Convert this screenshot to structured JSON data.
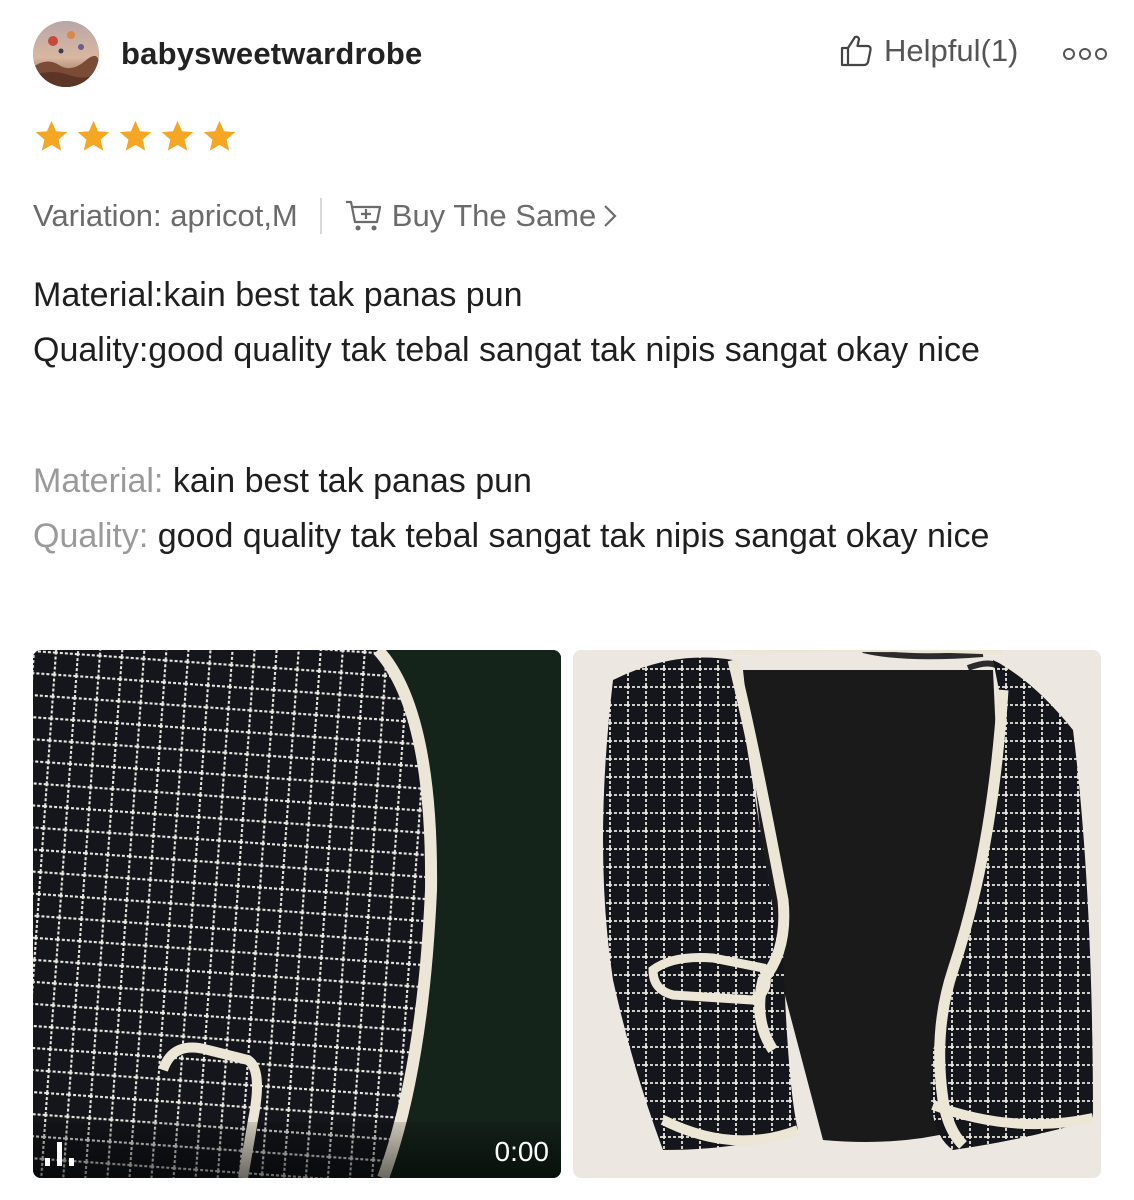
{
  "review": {
    "username": "babysweetwardrobe",
    "helpful_label": "Helpful(1)",
    "rating": 5,
    "variation": "Variation: apricot,M",
    "buy_same_label": "Buy The Same",
    "text_lines": [
      "Material:kain best tak panas pun",
      "Quality:good quality tak tebal sangat tak nipis sangat okay nice"
    ],
    "translated": {
      "material_key": "Material:",
      "material_value": " kain best tak panas pun",
      "quality_key": "Quality:",
      "quality_value": " good quality tak tebal sangat tak nipis sangat okay nice"
    }
  },
  "media": {
    "video_duration": "0:00"
  },
  "icons": {
    "avatar": "balloon-landscape-avatar",
    "helpful": "thumbs-up-icon",
    "more": "more-dots-icon",
    "star": "star-icon",
    "cart": "cart-plus-icon",
    "chevron": "chevron-right-icon",
    "video": "video-indicator-icon"
  },
  "colors": {
    "star": "#f5a623",
    "muted_text": "#6b6b6b",
    "key_text": "#9a9a9a",
    "fabric_dark": "#12151a",
    "trim": "#e9e3d5"
  }
}
